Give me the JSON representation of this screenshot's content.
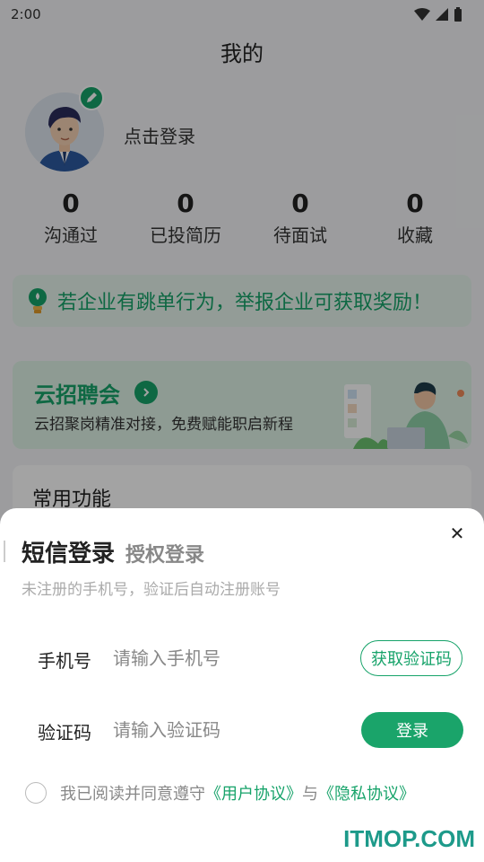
{
  "status_bar": {
    "time": "2:00",
    "icons": [
      "wifi-icon",
      "signal-icon",
      "battery-icon"
    ]
  },
  "header": {
    "title": "我的"
  },
  "profile": {
    "login_prompt": "点击登录"
  },
  "stats": [
    {
      "value": "0",
      "label": "沟通过"
    },
    {
      "value": "0",
      "label": "已投简历"
    },
    {
      "value": "0",
      "label": "待面试"
    },
    {
      "value": "0",
      "label": "收藏"
    }
  ],
  "report_banner": {
    "text": "若企业有跳单行为，举报企业可获取奖励！"
  },
  "cloud_recruit": {
    "title": "云招聘会",
    "subtitle": "云招聚岗精准对接，免费赋能职启新程"
  },
  "common_functions": {
    "title": "常用功能"
  },
  "login_sheet": {
    "tab_sms": "短信登录",
    "tab_auth": "授权登录",
    "hint": "未注册的手机号，验证后自动注册账号",
    "phone_label": "手机号",
    "phone_placeholder": "请输入手机号",
    "get_code_button": "获取验证码",
    "code_label": "验证码",
    "code_placeholder": "请输入验证码",
    "login_button": "登录",
    "agreement_prefix": "我已阅读并同意遵守",
    "user_agreement": "《用户协议》",
    "agreement_and": "与",
    "privacy_policy": "《隐私协议》"
  },
  "watermark": "ITMOP.COM",
  "colors": {
    "accent": "#17a36a",
    "overlay": "rgba(0,0,0,0.36)"
  }
}
